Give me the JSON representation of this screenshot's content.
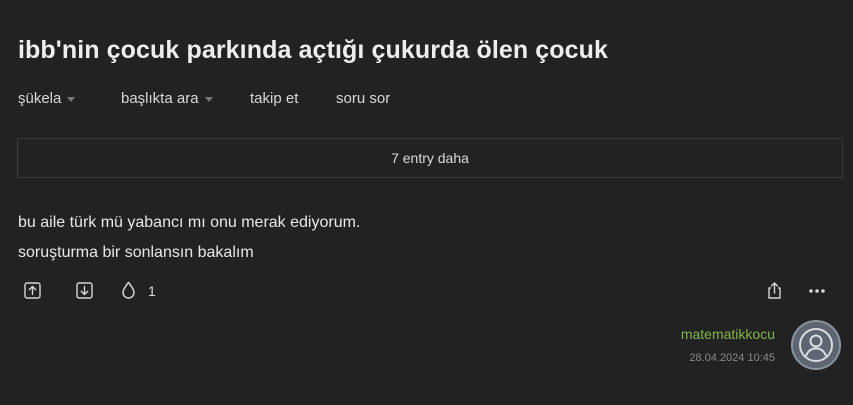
{
  "topic": {
    "title": "ibb'nin çocuk parkında açtığı çukurda ölen çocuk"
  },
  "toolbar": {
    "sort_label": "şükela",
    "search_label": "başlıkta ara",
    "follow_label": "takip et",
    "ask_label": "soru sor"
  },
  "more_entries": {
    "label": "7 entry daha"
  },
  "entry": {
    "lines": [
      "bu aile türk mü yabancı mı onu merak ediyorum.",
      "soruşturma bir sonlansın bakalım"
    ],
    "favorite_count": "1",
    "author": "matematikkocu",
    "date": "28.04.2024 10:45",
    "icons": [
      "upvote-icon",
      "downvote-icon",
      "favorite-drop-icon",
      "share-icon",
      "more-options-icon",
      "avatar-icon"
    ]
  },
  "colors": {
    "background": "#222222",
    "author": "#82b54b",
    "text": "#e6e6e6"
  }
}
